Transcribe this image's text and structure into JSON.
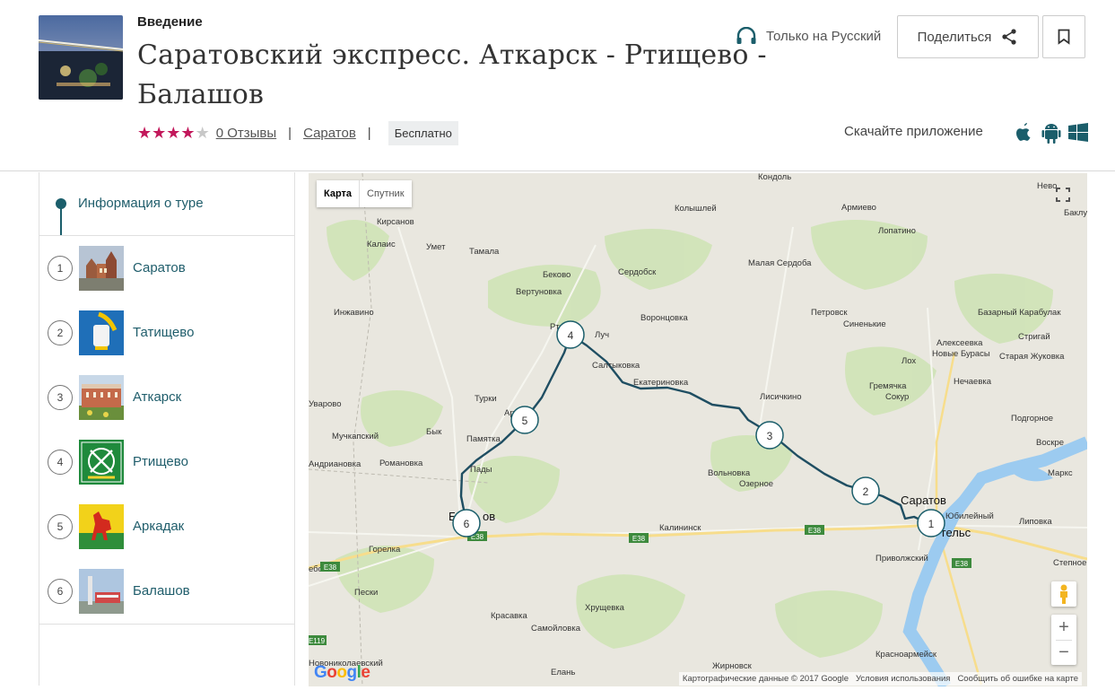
{
  "header": {
    "kicker": "Введение",
    "title": "Саратовский экспресс. Аткарск - Ртищево - Балашов",
    "rating": 4,
    "rating_max": 5,
    "reviews_link": "0 Отзывы",
    "city_link": "Саратов",
    "price_badge": "Бесплатно",
    "audio_language": "Только на Русский",
    "share_label": "Поделиться",
    "app_text": "Скачайте приложение",
    "colors": {
      "star": "#c2185b",
      "accent": "#1b5e6b"
    }
  },
  "sidebar": {
    "info_label": "Информация о туре",
    "stops": [
      {
        "num": "1",
        "name": "Саратов"
      },
      {
        "num": "2",
        "name": "Татищево"
      },
      {
        "num": "3",
        "name": "Аткарск"
      },
      {
        "num": "4",
        "name": "Ртищево"
      },
      {
        "num": "5",
        "name": "Аркадак"
      },
      {
        "num": "6",
        "name": "Балашов"
      }
    ]
  },
  "map": {
    "type_map": "Карта",
    "type_satellite": "Спутник",
    "logo": "Google",
    "copyright": "Картографические данные © 2017 Google",
    "terms": "Условия использования",
    "report": "Сообщить об ошибке на карте",
    "highway": "E38",
    "highway_left": "E38",
    "highway_e119": "E119",
    "places": {
      "kondol": "Кондоль",
      "armievo": "Армиево",
      "nevo": "Нево",
      "baklu": "Баклу",
      "kolyshley": "Колышлей",
      "kirsanov": "Кирсанов",
      "kalais": "Калаис",
      "umet": "Умет",
      "tamala": "Тамала",
      "lopatino": "Лопатино",
      "bekovo": "Беково",
      "serdobsk": "Сердобск",
      "malaya_serdoba": "Малая Сердоба",
      "vertunovka": "Вертуновка",
      "inzhavino": "Инжавино",
      "petrovsk": "Петровск",
      "sinenkie": "Синенькие",
      "bazarny_karabulak": "Базарный Карабулак",
      "vorontsovka": "Воронцовка",
      "luch": "Луч",
      "rtischevo_cut": "Ртищ",
      "striga": "Стригай",
      "alekseevka": "Алексеевка",
      "lokh": "Лох",
      "novye_burasy": "Новые Бурасы",
      "staraya_zhukovka": "Старая Жуковка",
      "saltykovka": "Салтыковка",
      "ekaterinovka": "Екатериновка",
      "gremyachka": "Гремячка",
      "nechaevka": "Нечаевка",
      "uvarovo": "Уварово",
      "turki": "Турки",
      "arkadak_cut": "Арк",
      "lisichkino": "Лисичкино",
      "sokur": "Сокур",
      "podgornoe": "Подгорное",
      "muchkapsky": "Мучкапский",
      "byk": "Бык",
      "pamyatka": "Памятка",
      "atkarsk_cut": "Ат",
      "voskresenskoe": "Воскре",
      "andrianovka": "Андриановка",
      "romanovka": "Романовка",
      "pady": "Пады",
      "volnovka": "Вольновка",
      "ozernoe": "Озерное",
      "marks": "Маркс",
      "saratov": "Саратов",
      "yubileyny": "Юбилейный",
      "balashov_cut": "Б",
      "balashov_tail": "ов",
      "kalininsk": "Калининск",
      "engels_tail": "гельс",
      "lipovka": "Липовка",
      "gorelka": "Горелка",
      "privolzhsky": "Приволжский",
      "stepnoe": "Степное",
      "ebsk": "ебск",
      "peski": "Пески",
      "khrushchevka": "Хрущевка",
      "krasavka": "Красавка",
      "samoylovka": "Самойловка",
      "krasnoarmeysk": "Красноармейск",
      "novonikolaevsky": "Новониколаевский",
      "zhirnovsk": "Жирновск",
      "elan": "Елань"
    }
  }
}
